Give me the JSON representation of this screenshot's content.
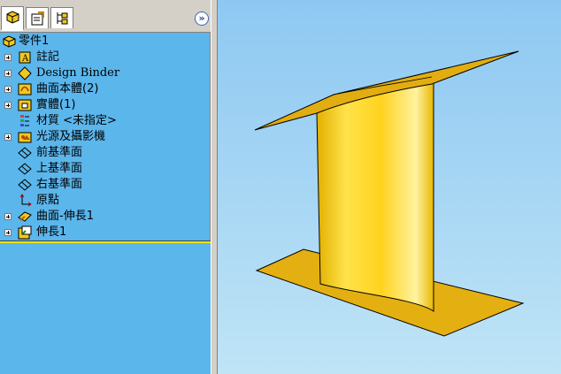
{
  "tabs": [
    {
      "name": "feature-manager",
      "icon": "feature-tree-icon"
    },
    {
      "name": "property-manager",
      "icon": "property-manager-icon"
    },
    {
      "name": "configuration-manager",
      "icon": "configuration-manager-icon"
    }
  ],
  "expand_glyph": "»",
  "tree": {
    "root": "零件1",
    "items": [
      {
        "label": "註記",
        "icon": "annotations-icon",
        "expandable": true
      },
      {
        "label": "Design Binder",
        "icon": "design-binder-icon",
        "expandable": true
      },
      {
        "label": "曲面本體(2)",
        "icon": "surface-bodies-icon",
        "expandable": true
      },
      {
        "label": "實體(1)",
        "icon": "solid-bodies-icon",
        "expandable": true
      },
      {
        "label": "材質 <未指定>",
        "icon": "material-icon",
        "expandable": false
      },
      {
        "label": "光源及攝影機",
        "icon": "lights-camera-icon",
        "expandable": true
      },
      {
        "label": "前基準面",
        "icon": "plane-icon",
        "expandable": false
      },
      {
        "label": "上基準面",
        "icon": "plane-icon",
        "expandable": false
      },
      {
        "label": "右基準面",
        "icon": "plane-icon",
        "expandable": false
      },
      {
        "label": "原點",
        "icon": "origin-icon",
        "expandable": false
      },
      {
        "label": "曲面-伸長1",
        "icon": "surface-extrude-icon",
        "expandable": true
      },
      {
        "label": "伸長1",
        "icon": "extrude-icon",
        "expandable": true
      }
    ]
  },
  "colors": {
    "tree_bg": "#5bb6ec",
    "model_yellow": "#f2c81e",
    "rollback_bar": "#f0e400"
  }
}
